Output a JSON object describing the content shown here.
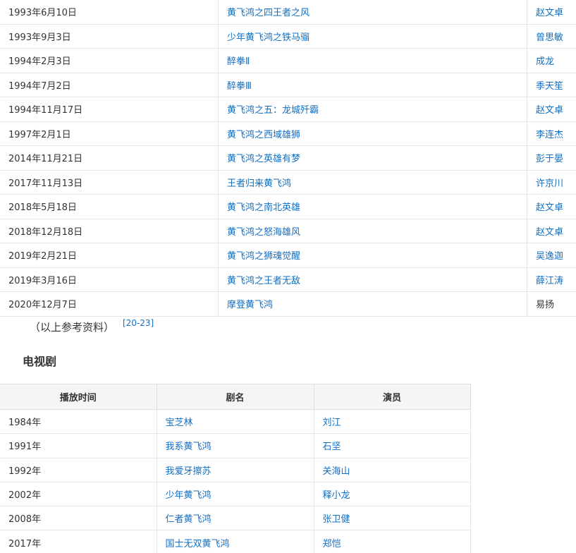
{
  "films": [
    {
      "date": "1993年6月10日",
      "title": "黄飞鸿之四王者之风",
      "actor": "赵文卓"
    },
    {
      "date": "1993年9月3日",
      "title": "少年黄飞鸿之铁马骝",
      "actor": "曾思敏"
    },
    {
      "date": "1994年2月3日",
      "title": "醉拳Ⅱ",
      "actor": "成龙"
    },
    {
      "date": "1994年7月2日",
      "title": "醉拳Ⅲ",
      "actor": "季天笙"
    },
    {
      "date": "1994年11月17日",
      "title": "黄飞鸿之五：龙城歼霸",
      "actor": "赵文卓"
    },
    {
      "date": "1997年2月1日",
      "title": "黄飞鸿之西域雄狮",
      "actor": "李连杰"
    },
    {
      "date": "2014年11月21日",
      "title": "黄飞鸿之英雄有梦",
      "actor": "彭于晏"
    },
    {
      "date": "2017年11月13日",
      "title": "王者归来黄飞鸿",
      "actor": "许京川"
    },
    {
      "date": "2018年5月18日",
      "title": "黄飞鸿之南北英雄",
      "actor": "赵文卓"
    },
    {
      "date": "2018年12月18日",
      "title": "黄飞鸿之怒海雄风",
      "actor": "赵文卓"
    },
    {
      "date": "2019年2月21日",
      "title": "黄飞鸿之狮魂觉醒",
      "actor": "吴逸迦"
    },
    {
      "date": "2019年3月16日",
      "title": "黄飞鸿之王者无敌",
      "actor": "薛江涛"
    },
    {
      "date": "2020年12月7日",
      "title": "摩登黄飞鸿",
      "actor": "易扬"
    }
  ],
  "reference_note": "（以上参考资料）",
  "reference_link": "[20-23]",
  "tv_section_title": "电视剧",
  "tv_headers": {
    "time": "播放时间",
    "title": "剧名",
    "actor": "演员"
  },
  "tv": [
    {
      "year": "1984年",
      "title": "宝芝林",
      "actor": "刘江"
    },
    {
      "year": "1991年",
      "title": "我系黄飞鸿",
      "actor": "石坚"
    },
    {
      "year": "1992年",
      "title": "我爱牙擦苏",
      "actor": "关海山"
    },
    {
      "year": "2002年",
      "title": "少年黄飞鸿",
      "actor": "释小龙"
    },
    {
      "year": "2008年",
      "title": "仁者黄飞鸿",
      "actor": "张卫健"
    },
    {
      "year": "2017年",
      "title": "国士无双黄飞鸿",
      "actor": "郑恺"
    }
  ],
  "colors": {
    "link": "#136ec2",
    "text": "#333333",
    "border": "#e6e6e6",
    "header_bg": "#f5f5f5"
  }
}
